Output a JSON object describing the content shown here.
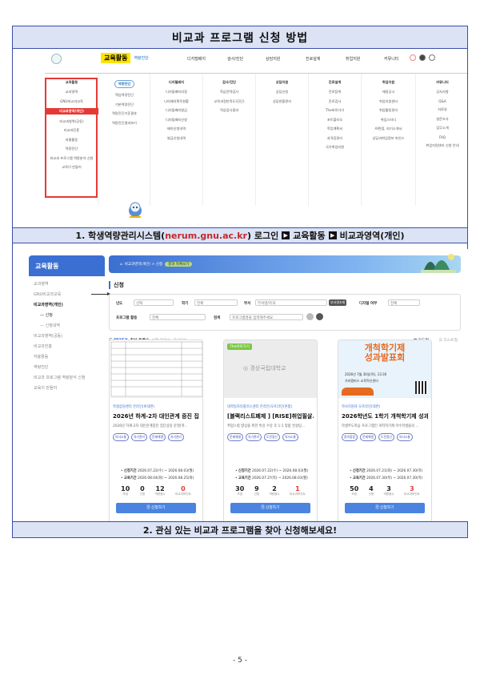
{
  "title": "비교과 프로그램 신청 방법",
  "step1": {
    "pre": "1. 학생역량관리시스템(",
    "url": "nerum.gnu.ac.kr",
    "mid": ") 로그인",
    "a": "교육활동",
    "b": "비교과영역(개인)",
    "arrow_icon": "▶"
  },
  "step2": "2. 관심 있는 비교과 프로그램을 찾아 신청해보세요!",
  "topnav": {
    "highlight": "교육활동",
    "sub": "역량진단",
    "items": [
      "교과활동",
      "역량진단",
      "디지털배지",
      "검사/진단",
      "상담지원",
      "진로설계",
      "취업지원",
      "커뮤니티"
    ]
  },
  "menu": {
    "columns": [
      {
        "head": "교육활동",
        "items": [
          "교과영역",
          "GNU비교과교육",
          "비교과영역(개인)",
          "비교과영역(공동)",
          "비교과진흥",
          "자율활동",
          "역량진단",
          "비교과 프로그램 역량분석 신청",
          "교육이 만들어"
        ]
      },
      {
        "head": "역량진단",
        "items": [
          "핵심역량진단",
          "기본역량진단",
          "역량진단기준결과",
          "역량진단결과보기"
        ]
      },
      {
        "head": "디지털배지",
        "items": [
          "디지털배지지정",
          "나의배지획득현황",
          "디지털배지발급",
          "디지털배지신청",
          "배지신청내역",
          "발급신청내역"
        ]
      },
      {
        "head": "검사/진단",
        "items": [
          "학습전략검사",
          "교육과정만족도(진단)",
          "적성검사결과"
        ]
      },
      {
        "head": "상담지원",
        "items": [
          "상담신청",
          "상담현황관리"
        ]
      },
      {
        "head": "진로설계",
        "items": [
          "진로탐색",
          "진로검사",
          "The바로가기",
          "포트폴리오",
          "학업계획서",
          "자격증관리",
          "국가취업지원"
        ]
      },
      {
        "head": "취업지원",
        "items": [
          "채용공고",
          "취업지원센터",
          "취업활동관리",
          "취업스터디",
          "AI면접, 자기소개서",
          "상담과취업정보 마인드"
        ]
      },
      {
        "head": "커뮤니티",
        "items": [
          "공지사항",
          "Q&A",
          "자료실",
          "설문조사",
          "업무소개",
          "FAQ",
          "취업지원센터 신청 안내"
        ]
      }
    ]
  },
  "sidebar": {
    "head": "교육활동",
    "items": [
      "교과영역",
      "GNU비교과교육",
      "비교과영역(개인)",
      "신청",
      "신청내역",
      "비교과영역(공동)",
      "비교과진흥",
      "자율활동",
      "역량진단",
      "비교과 프로그램 역량분석 신청",
      "교육이 만들어"
    ]
  },
  "crumb": {
    "path": "비교과영역(개인)  >  신청",
    "pill": "결과 목록보기"
  },
  "section": "신청",
  "filter": {
    "year_label": "년도",
    "year": "선택",
    "sem_label": "학기",
    "sem": "전체",
    "dept_label": "부서",
    "dept_ph": "부서명/학과",
    "dept_btn": "부서명조회",
    "digital_label": "디지털 여부",
    "digital": "전체",
    "prog_label": "프로그램 활동",
    "prog": "전체",
    "search_label": "검색",
    "search_ph": "프로그램명을 입력해주세요."
  },
  "results": {
    "count": "4915건",
    "sort1": "최신 등록순",
    "sort2": "신청 마감순",
    "sort3": "가나다순",
    "view": "카드형",
    "view2": "리스트형"
  },
  "cards": [
    {
      "org": "학생상담센터   온라인(비대면)",
      "title": "2026년 하계-2차 대인관계 증진 집...",
      "desc": "2026년 하계-2차 대인관계증진 집단상담 운영(학...",
      "tags": [
        "의사소통",
        "자기관리",
        "문제해결",
        "자기관리"
      ],
      "apply_period": "2026.07.22(수) ~ 2026.08.03(월)",
      "edu_period": "2026.08.04(화) ~ 2026.08.25(화)",
      "stats": [
        {
          "n": "10",
          "l": "모집"
        },
        {
          "n": "0",
          "l": "신청"
        },
        {
          "n": "12",
          "l": "역량점수"
        },
        {
          "n": "0",
          "l": "비교과포인트",
          "red": true
        }
      ],
      "apply_label": "신청하기"
    },
    {
      "org": "대학일자리플러스센터   온라인/오프라인(혼합)",
      "title": "[블랙리스트폐제 ] [RISE]취업필살...",
      "desc": "취업스킬 향상을 위한 특강 수강 후 1:1 맞춤 컨설팅...",
      "tags": [
        "문제해결",
        "자기관리",
        "도전정신",
        "의사소통"
      ],
      "apply_period": "2026.07.22(수) ~ 2026.08.03(월)",
      "edu_period": "2026.07.2?(목) ~ 2026.08.03(월)",
      "stats": [
        {
          "n": "30",
          "l": "모집"
        },
        {
          "n": "9",
          "l": "신청"
        },
        {
          "n": "2",
          "l": "역량점수"
        },
        {
          "n": "1",
          "l": "비교과포인트",
          "red": true
        }
      ],
      "apply_label": "신청하기",
      "badge": "The바로가기",
      "img_text": "경상국립대학교"
    },
    {
      "org": "학사지원과   오프라인(대면)",
      "title": "2026학년도 1학기 개척학기제 성과...",
      "desc": "학생주도학습 프로그램인 개척학기제 이수학생들의 ...",
      "tags": [
        "창의융합",
        "문제해결",
        "도전정신",
        "의사소통"
      ],
      "apply_period": "2026.07.21(화) ~ 2026.07.30(목)",
      "edu_period": "2026.07.30(목) ~ 2026.07.30(목)",
      "stats": [
        {
          "n": "50",
          "l": "모집"
        },
        {
          "n": "4",
          "l": "신청"
        },
        {
          "n": "3",
          "l": "역량점수"
        },
        {
          "n": "3",
          "l": "비교과포인트",
          "red": true
        }
      ],
      "apply_label": "신청하기",
      "poster_line1": "개척학기제",
      "poster_line2": "성과발표회",
      "poster_date": "2026년 7월 30일(목), 13:30",
      "poster_place": "가좌캠퍼스 교육혁신센터"
    }
  ],
  "page": "- 5 -",
  "colors": {
    "accent": "#3b6fd1",
    "frame": "#3b4fa8",
    "highlight": "#ffe400",
    "red": "#e53935"
  }
}
